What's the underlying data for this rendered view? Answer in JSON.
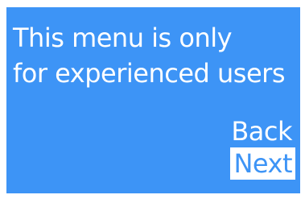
{
  "screen": {
    "background_color": "#3d94f6",
    "text_color": "#ffffff",
    "message_lines": [
      "This menu is only",
      "for experienced users"
    ]
  },
  "menu": {
    "items": [
      {
        "label": "Back",
        "selected": false
      },
      {
        "label": "Next",
        "selected": true
      }
    ],
    "selected_background": "#ffffff",
    "selected_text_color": "#3d94f6"
  }
}
